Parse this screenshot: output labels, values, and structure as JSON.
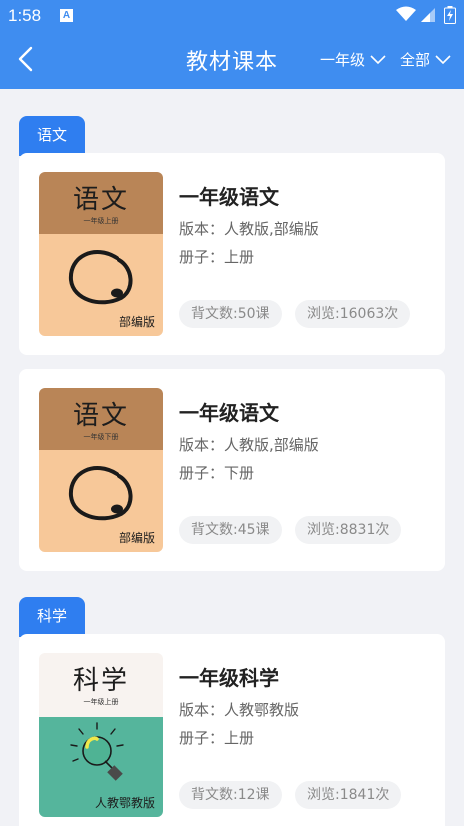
{
  "status": {
    "time": "1:58",
    "sim": "A"
  },
  "header": {
    "title": "教材课本",
    "grade_filter": "一年级",
    "scope_filter": "全部"
  },
  "sections": [
    {
      "label": "语文",
      "books": [
        {
          "title": "一年级语文",
          "edition": "版本：人教版,部编版",
          "volume": "册子：上册",
          "recite": "背文数:50课",
          "views": "浏览:16063次",
          "cover": {
            "title": "语文",
            "subtitle": "一年级上册",
            "badge": "部编版"
          }
        },
        {
          "title": "一年级语文",
          "edition": "版本：人教版,部编版",
          "volume": "册子：下册",
          "recite": "背文数:45课",
          "views": "浏览:8831次",
          "cover": {
            "title": "语文",
            "subtitle": "一年级下册",
            "badge": "部编版"
          }
        }
      ]
    },
    {
      "label": "科学",
      "books": [
        {
          "title": "一年级科学",
          "edition": "版本：人教鄂教版",
          "volume": "册子：上册",
          "recite": "背文数:12课",
          "views": "浏览:1841次",
          "cover": {
            "title": "科学",
            "subtitle": "一年级上册",
            "badge": "人教鄂教版"
          }
        }
      ]
    }
  ],
  "colors": {
    "header_blue": "#3f8df0",
    "section_tab_blue": "#2f7ef0",
    "chinese_cover_top": "#b98557",
    "chinese_cover_bottom": "#f7c899",
    "science_cover_top": "#f8f3f0",
    "science_cover_bottom": "#55b59c"
  },
  "icons": [
    "sim-card-icon",
    "wifi-icon",
    "cell-signal-icon",
    "battery-charging-icon",
    "back-arrow-icon",
    "chevron-down-icon",
    "ink-circle-icon",
    "lightbulb-icon"
  ]
}
